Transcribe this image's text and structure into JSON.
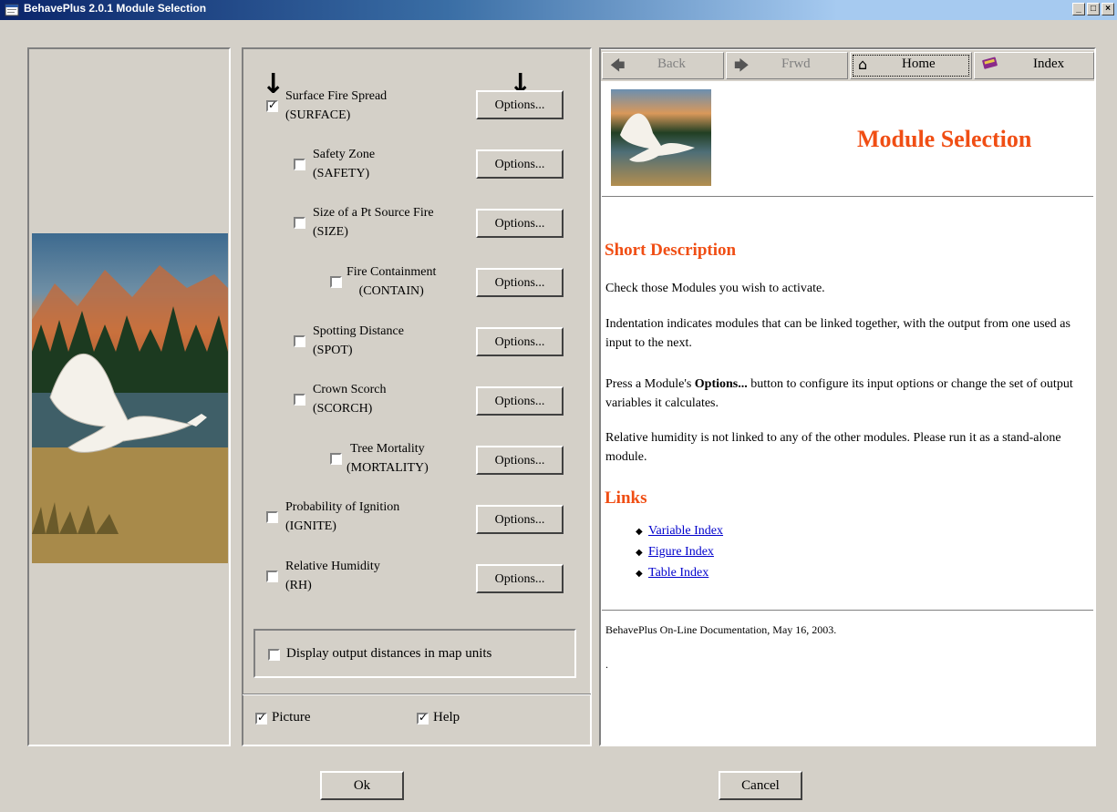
{
  "window": {
    "title": "BehavePlus 2.0.1 Module Selection",
    "minimize_label": "_",
    "maximize_label": "□",
    "close_label": "×"
  },
  "modules": [
    {
      "name": "Surface Fire Spread",
      "code": "(SURFACE)",
      "checked": true,
      "options_label": "Options..."
    },
    {
      "name": "Safety Zone",
      "code": "(SAFETY)",
      "checked": false,
      "options_label": "Options..."
    },
    {
      "name": "Size of a Pt Source Fire",
      "code": "(SIZE)",
      "checked": false,
      "options_label": "Options..."
    },
    {
      "name": "Fire Containment",
      "code": "(CONTAIN)",
      "checked": false,
      "options_label": "Options..."
    },
    {
      "name": "Spotting Distance",
      "code": "(SPOT)",
      "checked": false,
      "options_label": "Options..."
    },
    {
      "name": "Crown Scorch",
      "code": "(SCORCH)",
      "checked": false,
      "options_label": "Options..."
    },
    {
      "name": "Tree Mortality",
      "code": "(MORTALITY)",
      "checked": false,
      "options_label": "Options..."
    },
    {
      "name": "Probability of Ignition",
      "code": "(IGNITE)",
      "checked": false,
      "options_label": "Options..."
    },
    {
      "name": "Relative Humidity",
      "code": "(RH)",
      "checked": false,
      "options_label": "Options..."
    }
  ],
  "annotations": {
    "arrow_glyph": "↓"
  },
  "map_units": {
    "label": "Display output distances in map units",
    "checked": false
  },
  "view_toggles": {
    "picture_label": "Picture",
    "picture_checked": true,
    "help_label": "Help",
    "help_checked": true
  },
  "help_nav": {
    "back": "Back",
    "forward": "Frwd",
    "home": "Home",
    "index": "Index"
  },
  "help": {
    "heading": "Module Selection",
    "short_description_title": "Short Description",
    "paragraphs": {
      "p1": "Check those Modules you wish to activate.",
      "p2": "Indentation indicates modules that can be linked together, with the output from one used as input to the next.",
      "p3_prefix": "Press a Module's ",
      "p3_bold": "Options...",
      "p3_suffix": " button to configure its input options or change the set of output variables it calculates.",
      "p4": "Relative humidity is not linked to any of the other modules. Please run it as a stand-alone module."
    },
    "links_title": "Links",
    "links": [
      "Variable Index",
      "Figure Index",
      "Table Index"
    ],
    "footer": "BehavePlus On-Line Documentation, May 16, 2003.",
    "footer_dot": "."
  },
  "buttons": {
    "ok": "Ok",
    "cancel": "Cancel"
  },
  "colors": {
    "accent_orange": "#f04e14",
    "link_blue": "#0000cc",
    "titlebar": "#0a246a"
  }
}
